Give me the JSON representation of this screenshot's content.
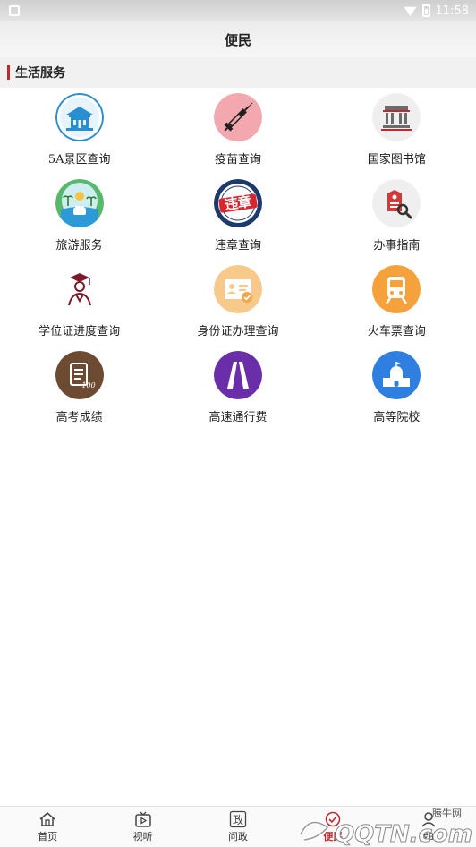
{
  "status_bar": {
    "time": "11:58"
  },
  "header": {
    "title": "便民"
  },
  "section": {
    "title": "生活服务"
  },
  "services": [
    {
      "label": "5A景区查询",
      "icon": "scenic-building-icon"
    },
    {
      "label": "疫苗查询",
      "icon": "vaccine-syringe-icon"
    },
    {
      "label": "国家图书馆",
      "icon": "library-building-icon"
    },
    {
      "label": "旅游服务",
      "icon": "travel-landscape-icon"
    },
    {
      "label": "违章查询",
      "icon": "violation-badge-icon"
    },
    {
      "label": "办事指南",
      "icon": "guide-search-icon"
    },
    {
      "label": "学位证进度查询",
      "icon": "graduate-icon"
    },
    {
      "label": "身份证办理查询",
      "icon": "id-card-icon"
    },
    {
      "label": "火车票查询",
      "icon": "train-icon"
    },
    {
      "label": "高考成绩",
      "icon": "exam-score-icon"
    },
    {
      "label": "高速通行费",
      "icon": "highway-icon"
    },
    {
      "label": "高等院校",
      "icon": "university-icon"
    }
  ],
  "icon_text": {
    "violation": "违章",
    "score": "100"
  },
  "bottom_nav": [
    {
      "label": "首页",
      "icon": "home-icon",
      "active": false
    },
    {
      "label": "视听",
      "icon": "tv-play-icon",
      "active": false
    },
    {
      "label": "问政",
      "icon": "politics-icon",
      "icon_text": "政",
      "active": false
    },
    {
      "label": "便民",
      "icon": "service-icon",
      "active": true
    },
    {
      "label": "我的",
      "icon": "profile-icon",
      "active": false
    }
  ],
  "watermark": {
    "text": "腾牛网",
    "logo": "QQTN.com"
  },
  "colors": {
    "accent": "#c0282d",
    "section_bg": "#f1f1f1"
  }
}
